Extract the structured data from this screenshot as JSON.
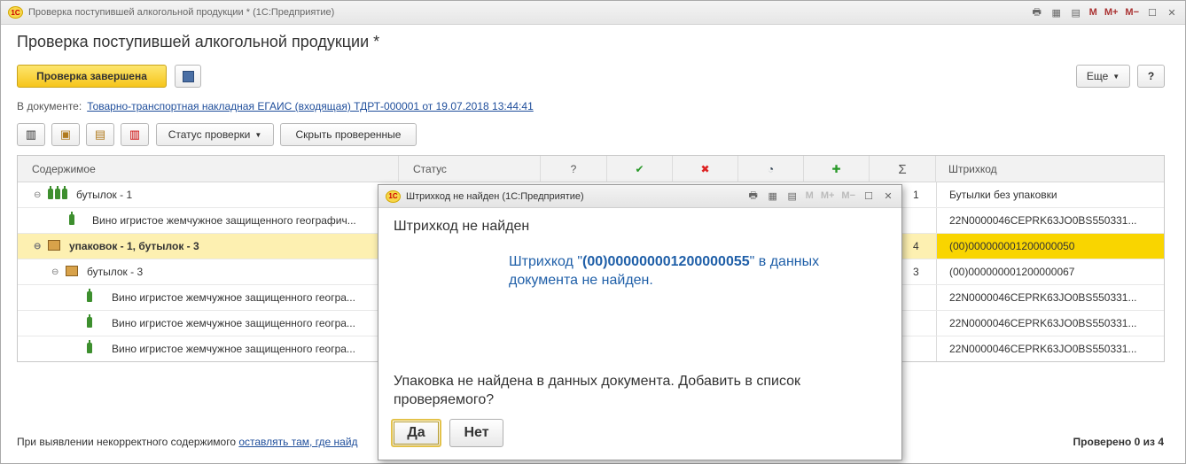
{
  "main": {
    "window_title": "Проверка поступившей алкогольной продукции * (1С:Предприятие)",
    "page_title": "Проверка поступившей алкогольной продукции *",
    "check_done_label": "Проверка завершена",
    "more_label": "Еще",
    "help_label": "?",
    "doc_prefix": "В документе:",
    "doc_link": "Товарно-транспортная накладная ЕГАИС (входящая) ТДРТ-000001 от 19.07.2018 13:44:41",
    "status_btn": "Статус проверки",
    "hide_checked_btn": "Скрыть проверенные",
    "titlebar_m": [
      "M",
      "M+",
      "M−"
    ]
  },
  "grid": {
    "headers": {
      "content": "Содержимое",
      "status": "Статус",
      "question": "?",
      "ok": "✔",
      "err": "✖",
      "partial": "◔",
      "plus": "✚",
      "sum": "Σ",
      "barcode": "Штрихкод"
    },
    "rows": [
      {
        "label": "бутылок -  1",
        "num": "1",
        "barcode": "Бутылки без упаковки"
      },
      {
        "label": "Вино игристое жемчужное защищенного географич...",
        "num": "",
        "barcode": "22N0000046CEPRK63JO0BS550331..."
      },
      {
        "label": "упаковок -  1, бутылок -  3",
        "num": "4",
        "barcode": "(00)000000001200000050"
      },
      {
        "label": "бутылок -  3",
        "num": "3",
        "barcode": "(00)000000001200000067"
      },
      {
        "label": "Вино игристое жемчужное защищенного геогра...",
        "num": "",
        "barcode": "22N0000046CEPRK63JO0BS550331..."
      },
      {
        "label": "Вино игристое жемчужное защищенного геогра...",
        "num": "",
        "barcode": "22N0000046CEPRK63JO0BS550331..."
      },
      {
        "label": "Вино игристое жемчужное защищенного геогра...",
        "num": "",
        "barcode": "22N0000046CEPRK63JO0BS550331..."
      }
    ]
  },
  "footer": {
    "text": "При выявлении некорректного содержимого",
    "link": "оставлять там, где найд",
    "checked": "Проверено 0 из 4"
  },
  "dialog": {
    "title": "Штрихкод не найден  (1С:Предприятие)",
    "heading": "Штрихкод не найден",
    "msg_before": "Штрихкод \"",
    "msg_code": "(00)000000001200000055",
    "msg_after": "\" в данных документа не найден.",
    "question": "Упаковка не найдена в данных документа. Добавить в список проверяемого?",
    "yes": "Да",
    "no": "Нет"
  }
}
